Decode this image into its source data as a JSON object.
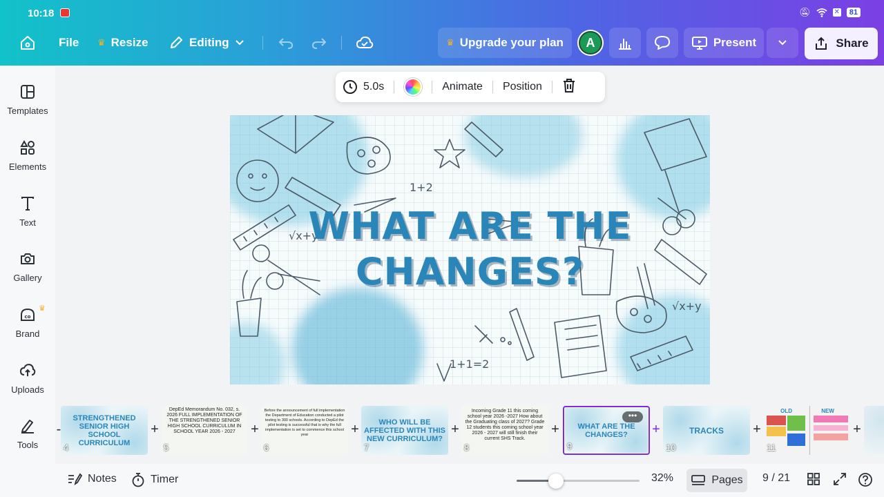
{
  "status_bar": {
    "time": "10:18",
    "battery": "81"
  },
  "toolbar": {
    "file": "File",
    "resize": "Resize",
    "editing": "Editing",
    "upgrade": "Upgrade your plan",
    "avatar_initial": "A",
    "present": "Present",
    "share": "Share"
  },
  "sidebar": {
    "items": [
      {
        "label": "Templates",
        "icon": "templates-icon"
      },
      {
        "label": "Elements",
        "icon": "elements-icon"
      },
      {
        "label": "Text",
        "icon": "text-icon"
      },
      {
        "label": "Gallery",
        "icon": "camera-icon"
      },
      {
        "label": "Brand",
        "icon": "brand-icon"
      },
      {
        "label": "Uploads",
        "icon": "upload-icon"
      },
      {
        "label": "Tools",
        "icon": "tools-icon"
      }
    ]
  },
  "context_toolbar": {
    "duration": "5.0s",
    "animate": "Animate",
    "position": "Position"
  },
  "slide": {
    "title_line1": "WHAT ARE THE",
    "title_line2": "CHANGES?",
    "doodle_1": "1+2",
    "doodle_2": "1+1=2",
    "doodle_3": "√x+y"
  },
  "filmstrip": {
    "thumbs": [
      {
        "num": "4",
        "title": "STRENGTHENED SENIOR HIGH SCHOOL CURRICULUM",
        "small": ""
      },
      {
        "num": "5",
        "title": "",
        "small": "DepEd Memorandum No. 032, s. 2026 FULL IMPLEMENTATION OF THE STRENGTHENED SENIOR HIGH SCHOOL CURRICULUM IN SCHOOL YEAR 2026 - 2027"
      },
      {
        "num": "6",
        "title": "",
        "small": "Before the announcement of full implementation the Department of Education conducted a pilot testing to 300 schools. According to DepEd the pilot testing is successful that is why the full implementation is set to commence this school year"
      },
      {
        "num": "7",
        "title": "WHO WILL BE AFFECTED WITH THIS NEW CURRICULUM?",
        "small": ""
      },
      {
        "num": "8",
        "title": "",
        "small": "Incoming Grade 11 this coming school year 2026 -2027 How about the Graduating class of 2027? Grade 12 students this coming school year 2026 - 2027 will still finish their current SHS Track."
      },
      {
        "num": "9",
        "title": "WHAT ARE THE CHANGES?",
        "small": "",
        "active": true
      },
      {
        "num": "10",
        "title": "TRACKS",
        "small": ""
      },
      {
        "num": "11",
        "title": "",
        "small": "OLD NEW"
      }
    ],
    "more_label": "•••"
  },
  "bottom_bar": {
    "notes": "Notes",
    "timer": "Timer",
    "zoom": "32%",
    "zoom_level": 0.32,
    "pages": "Pages",
    "page_count": "9 / 21"
  },
  "colors": {
    "accent": "#7d2ae8",
    "title_blue": "#2a86b8",
    "avatar_green": "#1b9a55"
  }
}
